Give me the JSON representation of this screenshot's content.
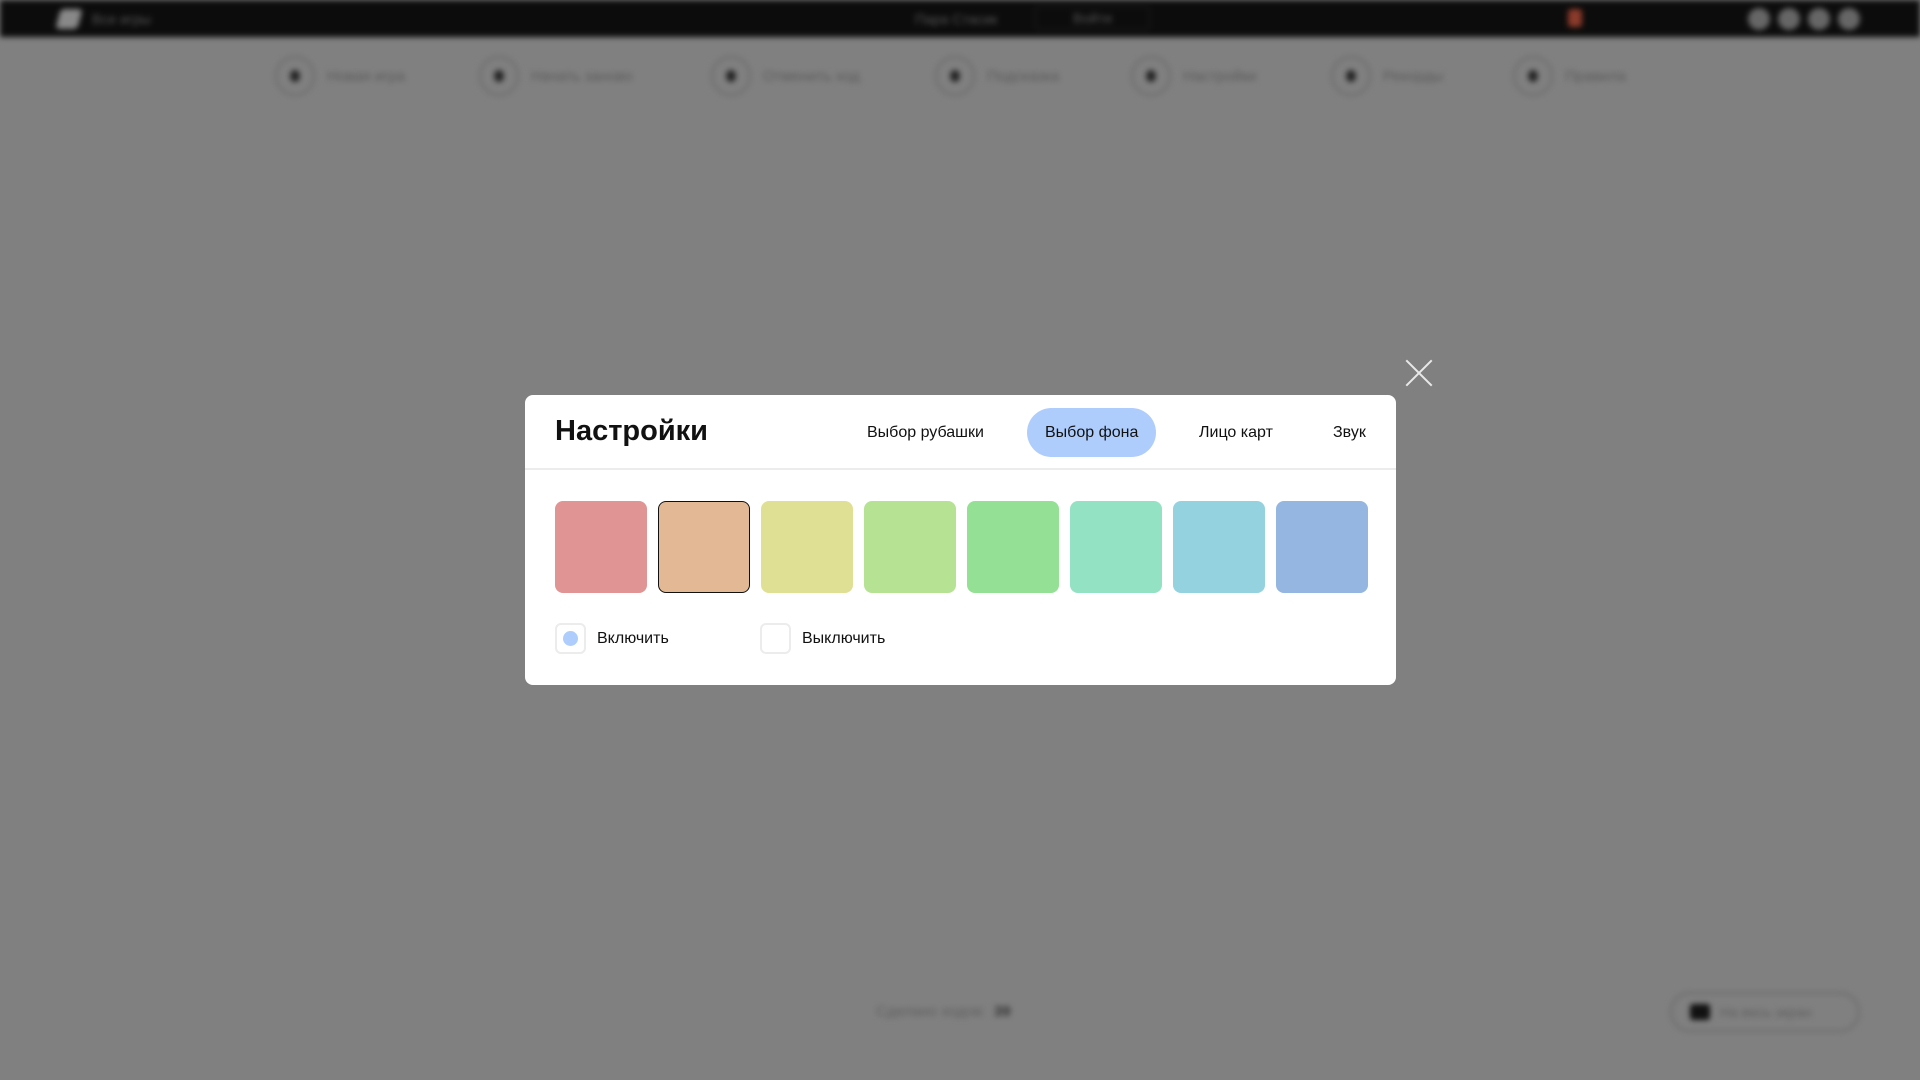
{
  "topbar": {
    "all_games": "Все игры",
    "game_title": "Пара Стасик",
    "login": "Войти"
  },
  "toolbar": [
    {
      "label": "Новая игра",
      "icon": "play-icon"
    },
    {
      "label": "Начать заново",
      "icon": "restart-icon"
    },
    {
      "label": "Отменить ход",
      "icon": "undo-icon"
    },
    {
      "label": "Подсказка",
      "icon": "hint-icon"
    },
    {
      "label": "Настройки",
      "icon": "gear-icon"
    },
    {
      "label": "Рекорды",
      "icon": "trophy-icon"
    },
    {
      "label": "Правила",
      "icon": "info-icon"
    }
  ],
  "footer": {
    "moves_label": "Сделано ходов:",
    "moves": "39",
    "fullscreen": "На весь экран"
  },
  "modal": {
    "title": "Настройки",
    "tabs": [
      {
        "label": "Выбор рубашки"
      },
      {
        "label": "Выбор фона",
        "active": true
      },
      {
        "label": "Лицо карт"
      },
      {
        "label": "Звук"
      }
    ],
    "swatches": [
      "#e09494",
      "#e2b994",
      "#e0e094",
      "#b6e294",
      "#94e094",
      "#94e2c4",
      "#94d2e0",
      "#94b6e0"
    ],
    "selected_swatch": 1,
    "options": {
      "enable": "Включить",
      "disable": "Выключить",
      "selected": "enable"
    }
  }
}
